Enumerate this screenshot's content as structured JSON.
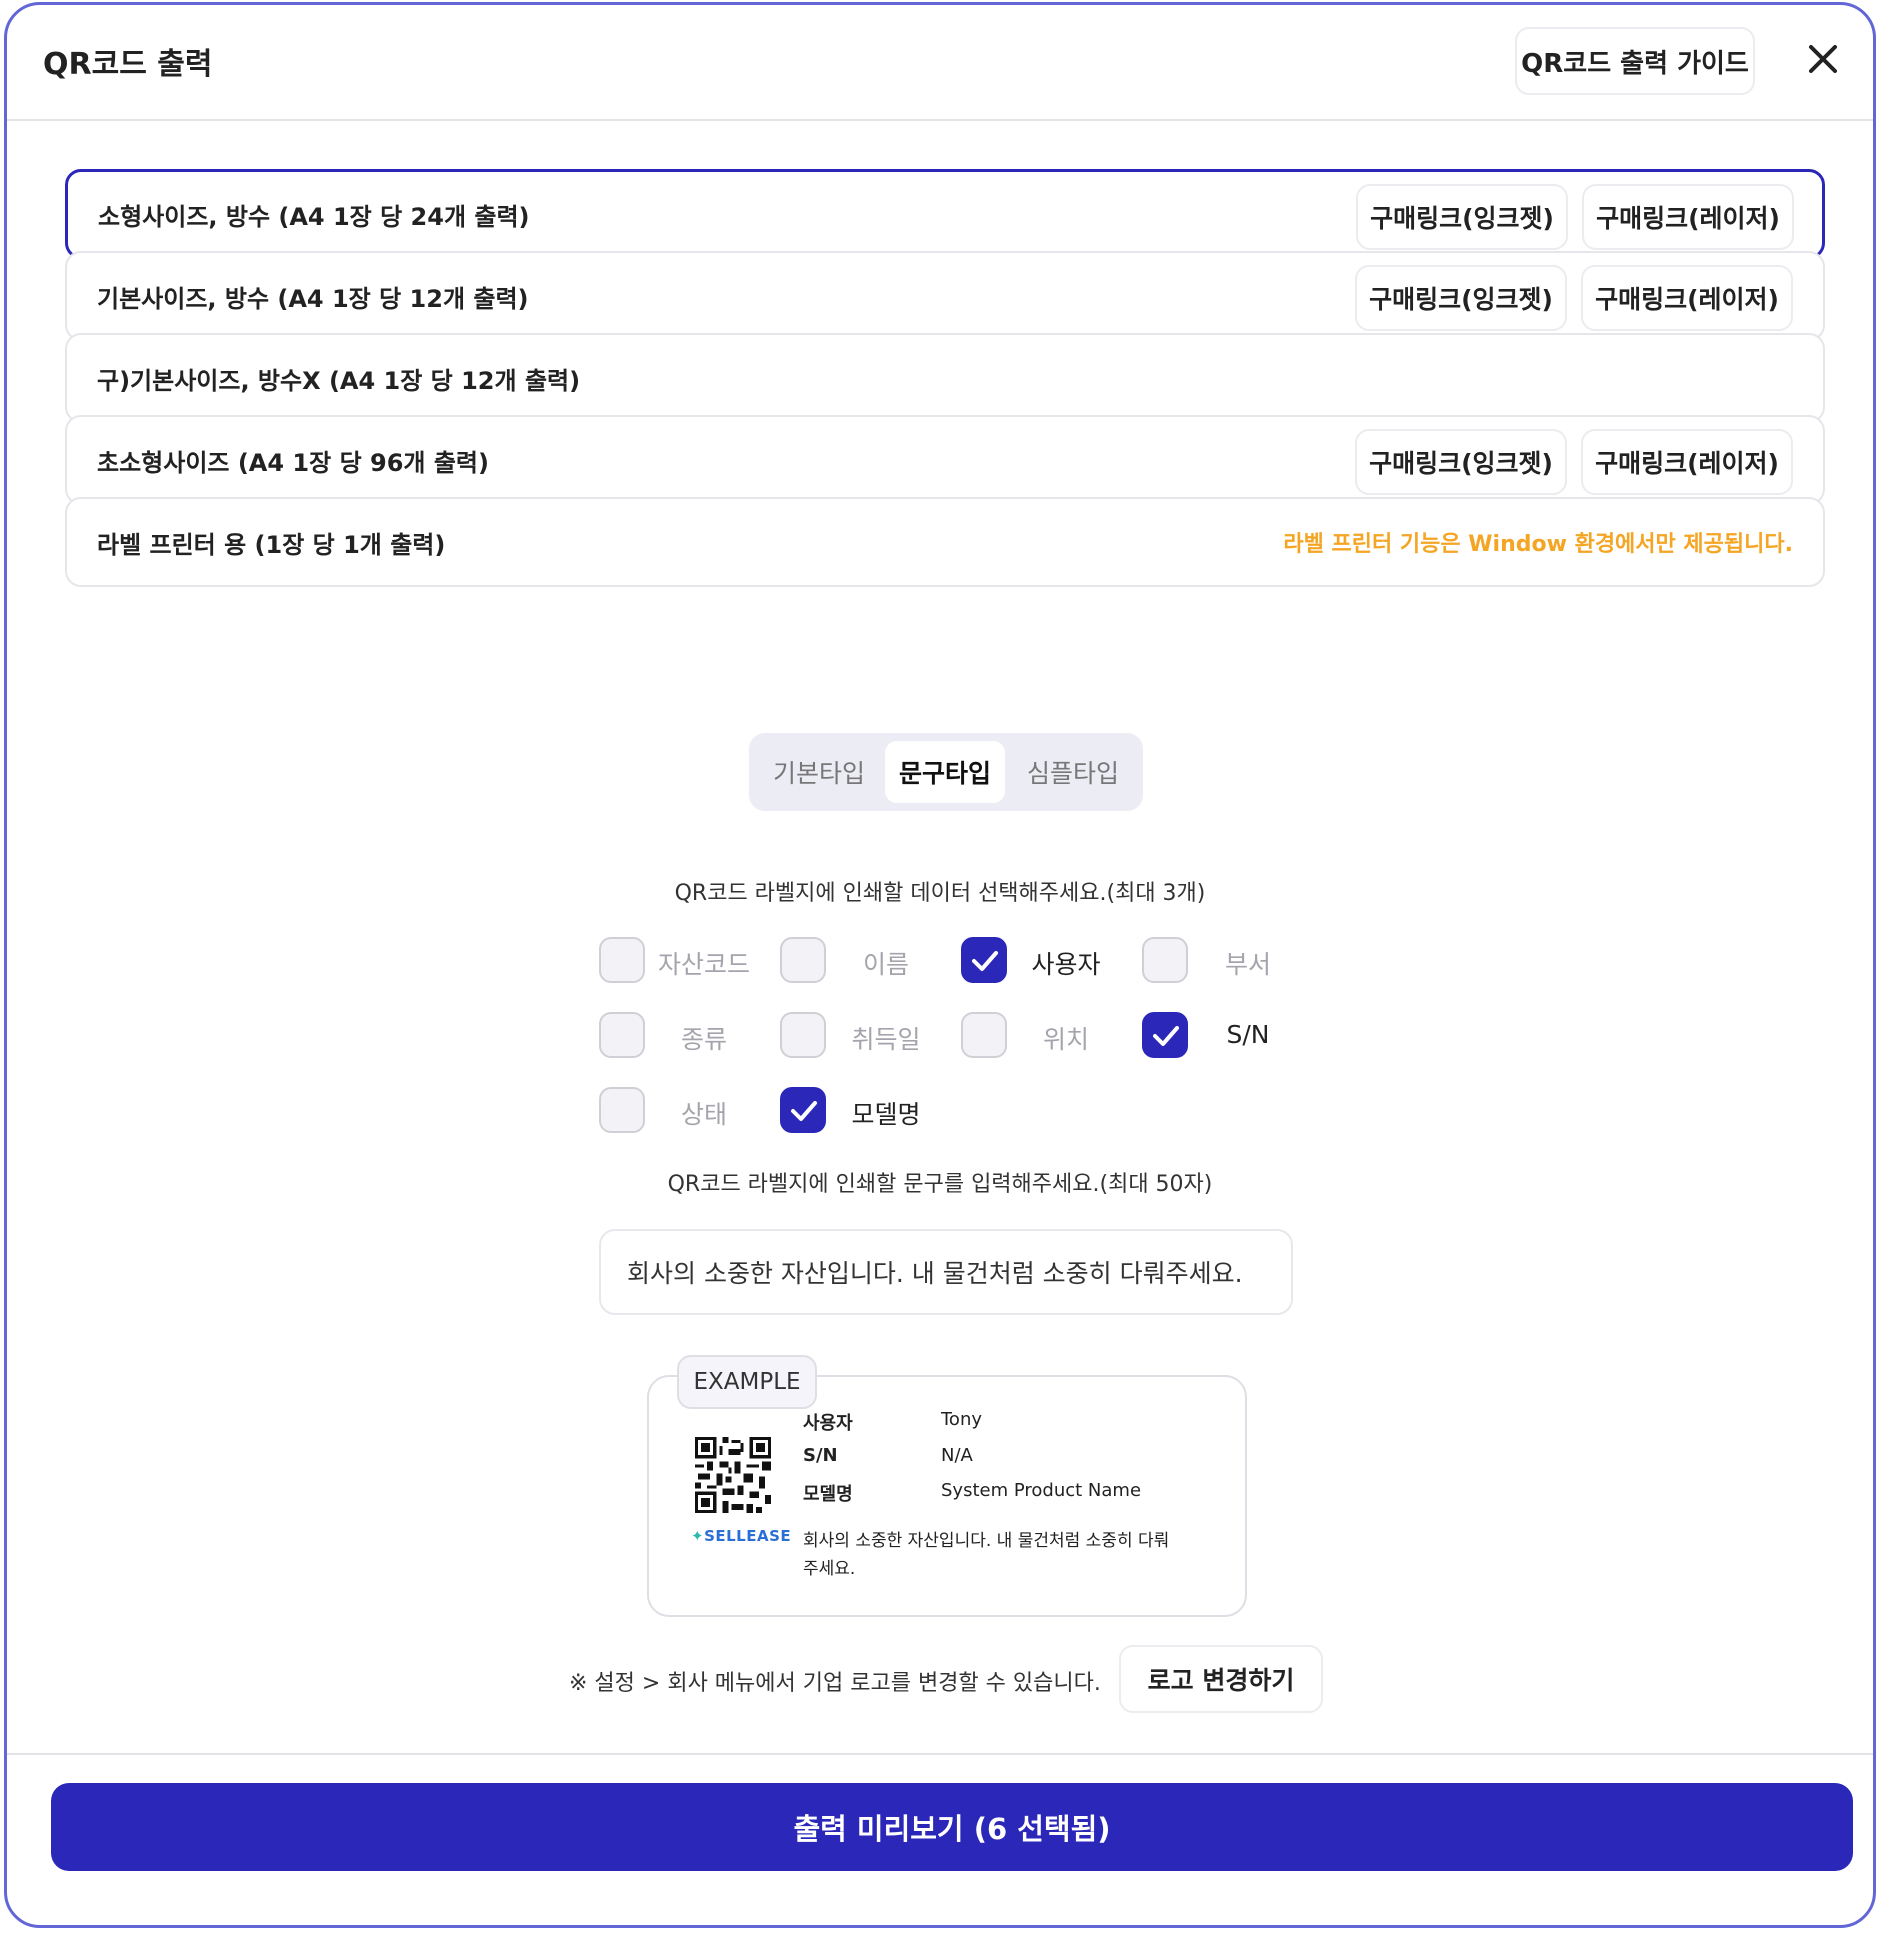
{
  "header": {
    "title": "QR코드 출력",
    "guide_label": "QR코드 출력 가이드"
  },
  "options": [
    {
      "label": "소형사이즈, 방수 (A4 1장 당 24개 출력)",
      "buy_inkjet": "구매링크(잉크젯)",
      "buy_laser": "구매링크(레이저)",
      "selected": true
    },
    {
      "label": "기본사이즈, 방수 (A4 1장 당 12개 출력)",
      "buy_inkjet": "구매링크(잉크젯)",
      "buy_laser": "구매링크(레이저)"
    },
    {
      "label": "구)기본사이즈, 방수X (A4 1장 당 12개 출력)"
    },
    {
      "label": "초소형사이즈 (A4 1장 당 96개 출력)",
      "buy_inkjet": "구매링크(잉크젯)",
      "buy_laser": "구매링크(레이저)"
    },
    {
      "label": "라벨 프린터 용 (1장 당 1개 출력)",
      "notice": "라벨 프린터 기능은 Window 환경에서만 제공됩니다."
    }
  ],
  "tabs": [
    {
      "label": "기본타입"
    },
    {
      "label": "문구타입",
      "active": true
    },
    {
      "label": "심플타입"
    }
  ],
  "data_instruction": "QR코드 라벨지에 인쇄할 데이터 선택해주세요.(최대 3개)",
  "fields": [
    {
      "label": "자산코드",
      "checked": false
    },
    {
      "label": "이름",
      "checked": false
    },
    {
      "label": "사용자",
      "checked": true
    },
    {
      "label": "부서",
      "checked": false
    },
    {
      "label": "종류",
      "checked": false
    },
    {
      "label": "취득일",
      "checked": false
    },
    {
      "label": "위치",
      "checked": false
    },
    {
      "label": "S/N",
      "checked": true
    },
    {
      "label": "상태",
      "checked": false
    },
    {
      "label": "모델명",
      "checked": true
    }
  ],
  "message_instruction": "QR코드 라벨지에 인쇄할 문구를 입력해주세요.(최대 50자)",
  "message_value": "회사의 소중한 자산입니다. 내 물건처럼 소중히 다뤄주세요.",
  "example": {
    "tag": "EXAMPLE",
    "rows": [
      {
        "key": "사용자",
        "value": "Tony"
      },
      {
        "key": "S/N",
        "value": "N/A"
      },
      {
        "key": "모델명",
        "value": "System Product Name"
      }
    ],
    "brand": "SELLEASE",
    "message": "회사의 소중한 자산입니다. 내 물건처럼 소중히 다뤄주세요."
  },
  "logo_note": "※ 설정 > 회사 메뉴에서 기업 로고를 변경할 수 있습니다.",
  "logo_button": "로고 변경하기",
  "preview_button": "출력 미리보기 (6 선택됨)",
  "colors": {
    "accent": "#2b27b8",
    "notice": "#f5a524",
    "border_accent": "#6266d6"
  }
}
